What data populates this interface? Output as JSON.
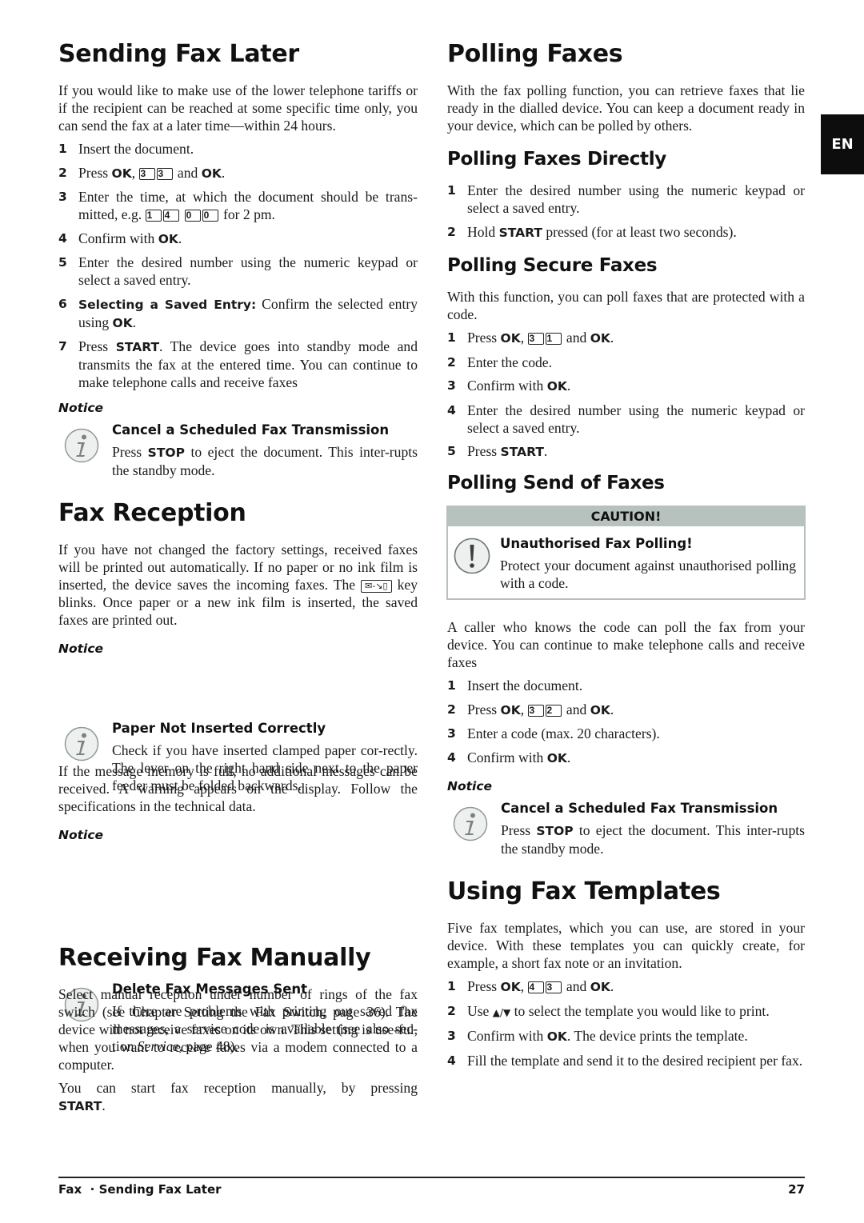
{
  "left": {
    "sending_later": {
      "title": "Sending Fax Later",
      "intro": "If you would like to make use of the lower telephone tariffs or if the recipient can be reached at some specific time only, you can send the fax at a later time—within 24 hours.",
      "steps": [
        {
          "num": "1",
          "text": "Insert the document."
        },
        {
          "num": "2",
          "pre": "Press ",
          "b1": "OK",
          "mid": ", ",
          "keys": [
            "3",
            "3"
          ],
          "post": " and ",
          "b2": "OK",
          "end": "."
        },
        {
          "num": "3",
          "pre": "Enter the time, at which the document should be trans-mitted, e.g. ",
          "keys": [
            "1",
            "4",
            "0",
            "0"
          ],
          "post": " for 2 pm."
        },
        {
          "num": "4",
          "pre": "Confirm with ",
          "b1": "OK",
          "end": "."
        },
        {
          "num": "5",
          "text": "Enter the desired number using the numeric keypad or select a saved entry."
        },
        {
          "num": "6",
          "b1": "Selecting a Saved Entry:",
          "mid": " Confirm the selected entry using ",
          "b2": "OK",
          "end": "."
        },
        {
          "num": "7",
          "pre": "Press ",
          "b1": "START",
          "post": ". The device goes into standby mode and transmits the fax at the entered time. You can continue to make telephone calls and receive faxes"
        }
      ],
      "notice": {
        "label": "Notice",
        "title": "Cancel a Scheduled Fax Transmission",
        "pre": "Press ",
        "bold": "STOP",
        "post": " to eject the document. This inter-rupts the standby mode."
      }
    },
    "fax_reception": {
      "title": "Fax Reception",
      "intro_1": "If you have not changed the factory settings, received faxes will be printed out automatically. If no paper or no ink film is inserted, the device saves the incoming faxes.  The ",
      "key_glyph": "✉-↘▯",
      "intro_2": " key blinks. Once paper or a new ink film is inserted, the saved faxes are printed out.",
      "notice_1": {
        "label": "Notice",
        "title": "Paper Not Inserted Correctly",
        "text": "Check if you have inserted clamped paper cor-rectly. The lever on the right hand side next to the paper feeder must be folded backwards."
      },
      "para": "If the message memory is full, no additional messages can be received. A warning appears on the display. Follow the specifications in the technical data.",
      "notice_2": {
        "label": "Notice",
        "title": "Delete Fax Messages Sent",
        "pre": "If there are problems with printing out saved fax messages, a service code is available (see also sec-tion ",
        "italic": "Service",
        "post": ", page 48)."
      }
    },
    "receiving_manually": {
      "title": "Receiving Fax Manually",
      "para_1": "Select manual reception under number of rings of the fax switch (see Chapter Setting the Fax Switch, page 36). The device will not receive faxes on its own. This setting is use-ful, when you want to receive faxes via a modem connected to a computer.",
      "para_2_pre": "You can start fax reception manually, by pressing ",
      "para_2_bold": "START",
      "para_2_post": "."
    }
  },
  "right": {
    "polling": {
      "title": "Polling Faxes",
      "intro": "With the fax polling function, you can retrieve faxes that lie ready in the dialled device.  You can keep a document ready in your device, which can be polled by others."
    },
    "polling_directly": {
      "title": "Polling Faxes Directly",
      "steps": [
        {
          "num": "1",
          "text": "Enter the desired number using the numeric keypad or select a saved entry."
        },
        {
          "num": "2",
          "pre": "Hold ",
          "b1": "START",
          "post": " pressed (for at least two seconds)."
        }
      ]
    },
    "polling_secure": {
      "title": "Polling Secure Faxes",
      "intro": "With this function, you can poll faxes that are protected with a code.",
      "steps": [
        {
          "num": "1",
          "pre": "Press ",
          "b1": "OK",
          "mid": ", ",
          "keys": [
            "3",
            "1"
          ],
          "post": " and ",
          "b2": "OK",
          "end": "."
        },
        {
          "num": "2",
          "text": "Enter the code."
        },
        {
          "num": "3",
          "pre": "Confirm with ",
          "b1": "OK",
          "end": "."
        },
        {
          "num": "4",
          "text": "Enter the desired number using the numeric keypad or select a saved entry."
        },
        {
          "num": "5",
          "pre": "Press ",
          "b1": "START",
          "end": "."
        }
      ]
    },
    "polling_send": {
      "title": "Polling Send of Faxes",
      "caution": {
        "header": "CAUTION!",
        "title": "Unauthorised Fax Polling!",
        "text": "Protect your document against unauthorised polling with a code."
      },
      "intro": "A caller who knows the code can poll the fax from your device. You can continue to make telephone calls and receive faxes",
      "steps": [
        {
          "num": "1",
          "text": "Insert the document."
        },
        {
          "num": "2",
          "pre": "Press ",
          "b1": "OK",
          "mid": ", ",
          "keys": [
            "3",
            "2"
          ],
          "post": " and ",
          "b2": "OK",
          "end": "."
        },
        {
          "num": "3",
          "text": "Enter a code (max. 20 characters)."
        },
        {
          "num": "4",
          "pre": "Confirm with ",
          "b1": "OK",
          "end": "."
        }
      ],
      "notice": {
        "label": "Notice",
        "title": "Cancel a Scheduled Fax Transmission",
        "pre": "Press ",
        "bold": "STOP",
        "post": " to eject the document. This inter-rupts the standby mode."
      }
    },
    "templates": {
      "title": "Using Fax Templates",
      "intro": "Five fax templates, which you can use, are stored in your device. With these templates you can quickly create, for example, a short fax note or an invitation.",
      "steps": [
        {
          "num": "1",
          "pre": "Press ",
          "b1": "OK",
          "mid": ", ",
          "keys": [
            "4",
            "3"
          ],
          "post": " and ",
          "b2": "OK",
          "end": "."
        },
        {
          "num": "2",
          "pre": "Use ",
          "arrows": "▲/▼",
          "post": " to select the template you would like to print."
        },
        {
          "num": "3",
          "pre": "Confirm with ",
          "b1": "OK",
          "post": ". The device prints the template."
        },
        {
          "num": "4",
          "text": "Fill the template and send it to the desired recipient per fax."
        }
      ]
    }
  },
  "language_tab": "EN",
  "footer": {
    "chapter": "Fax",
    "separator": "·",
    "section": "Sending Fax Later",
    "page": "27"
  }
}
